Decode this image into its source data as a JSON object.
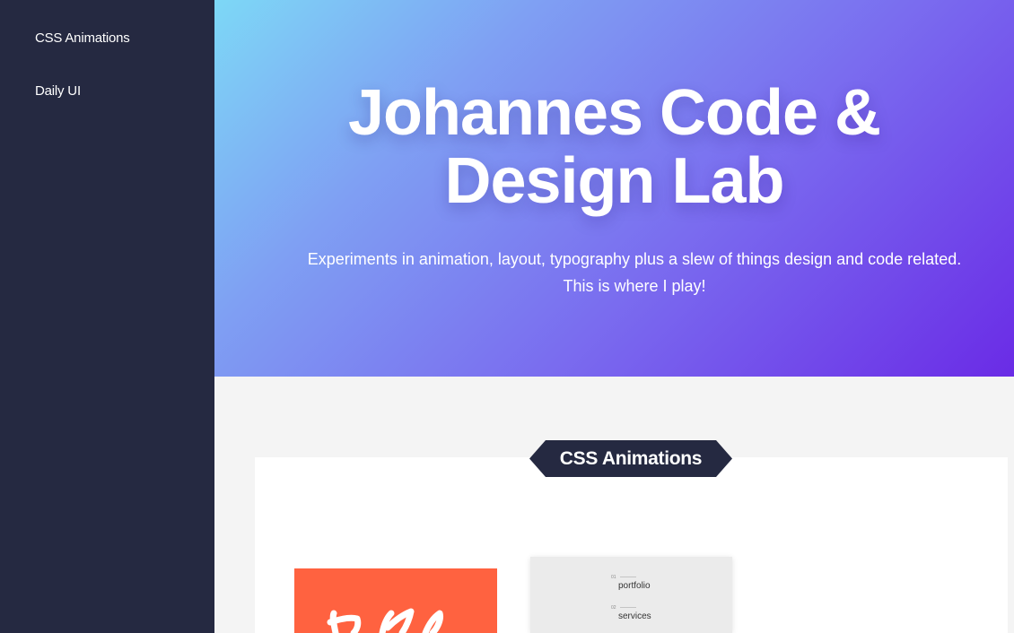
{
  "sidebar": {
    "items": [
      {
        "label": "CSS Animations"
      },
      {
        "label": "Daily UI"
      }
    ]
  },
  "hero": {
    "title_line1": "Johannes Code &",
    "title_line2": "Design Lab",
    "subtitle_line1": "Experiments in animation, layout, typography plus a slew of things design and code related.",
    "subtitle_line2": "This is where I play!"
  },
  "section": {
    "heading": "CSS Animations"
  },
  "menu_card": {
    "items": [
      {
        "number": "01",
        "label": "portfolio"
      },
      {
        "number": "02",
        "label": "services"
      }
    ]
  },
  "colors": {
    "sidebar_bg": "#252941",
    "hero_gradient_start": "#7dd8f6",
    "hero_gradient_end": "#6a2be6",
    "ribbon_bg": "#252941",
    "orange_card": "#ff6240"
  }
}
